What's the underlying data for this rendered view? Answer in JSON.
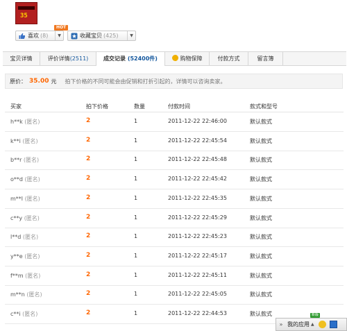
{
  "product": {
    "thumb_number": "35"
  },
  "actions": {
    "like_label": "喜欢",
    "like_count": "(8)",
    "hot_badge": "HOT",
    "favorite_label": "收藏宝贝",
    "favorite_count": "(425)"
  },
  "tabs": [
    {
      "label": "宝贝详情",
      "count": ""
    },
    {
      "label": "评价详情",
      "count": "(2511)"
    },
    {
      "label": "成交记录",
      "count": "(52400件)"
    },
    {
      "label": "购物保障",
      "count": ""
    },
    {
      "label": "付款方式",
      "count": ""
    },
    {
      "label": "留言簿",
      "count": ""
    }
  ],
  "price_info": {
    "label": "原价：",
    "value": "35.00",
    "unit": "元",
    "note": "拍下价格的不同可能会由促销和打折引起的，详情可以咨询卖家。"
  },
  "table": {
    "headers": {
      "buyer": "买家",
      "price": "拍下价格",
      "qty": "数量",
      "time": "付款时间",
      "model": "款式和型号"
    },
    "anon_label": "(匿名)",
    "rows": [
      {
        "buyer": "h**k",
        "price": "2",
        "qty": "1",
        "time": "2011-12-22 22:46:00",
        "model": "默认款式"
      },
      {
        "buyer": "k**i",
        "price": "2",
        "qty": "1",
        "time": "2011-12-22 22:45:54",
        "model": "默认款式"
      },
      {
        "buyer": "b**r",
        "price": "2",
        "qty": "1",
        "time": "2011-12-22 22:45:48",
        "model": "默认款式"
      },
      {
        "buyer": "o**d",
        "price": "2",
        "qty": "1",
        "time": "2011-12-22 22:45:42",
        "model": "默认款式"
      },
      {
        "buyer": "m**l",
        "price": "2",
        "qty": "1",
        "time": "2011-12-22 22:45:35",
        "model": "默认款式"
      },
      {
        "buyer": "c**y",
        "price": "2",
        "qty": "1",
        "time": "2011-12-22 22:45:29",
        "model": "默认款式"
      },
      {
        "buyer": "l**d",
        "price": "2",
        "qty": "1",
        "time": "2011-12-22 22:45:23",
        "model": "默认款式"
      },
      {
        "buyer": "y**e",
        "price": "2",
        "qty": "1",
        "time": "2011-12-22 22:45:17",
        "model": "默认款式"
      },
      {
        "buyer": "f**m",
        "price": "2",
        "qty": "1",
        "time": "2011-12-22 22:45:11",
        "model": "默认款式"
      },
      {
        "buyer": "m**n",
        "price": "2",
        "qty": "1",
        "time": "2011-12-22 22:45:05",
        "model": "默认款式"
      },
      {
        "buyer": "c**i",
        "price": "2",
        "qty": "1",
        "time": "2011-12-22 22:44:53",
        "model": "默认款式"
      }
    ]
  },
  "app_bar": {
    "label": "我的应用",
    "new_badge": "新版"
  },
  "colors": {
    "accent_orange": "#ff6600",
    "count_blue": "#15589e"
  }
}
